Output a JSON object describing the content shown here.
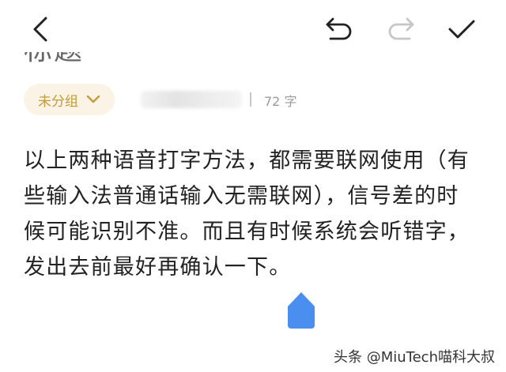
{
  "note": {
    "title": "标题",
    "group_label": "未分组",
    "char_count": "72 字",
    "body_lines": [
      "以上两种语音打字方法，都需要联网使用（有",
      "些输入法普通话输入无需联网），信号差的时",
      "候可能识别不准。而且有时候系统会听错字，",
      "发出去前最好再确认一下。"
    ]
  },
  "toolbar": {
    "back_icon": "chevron-left-icon",
    "undo_icon": "undo-icon",
    "redo_icon": "redo-icon",
    "redo_enabled": false,
    "done_icon": "checkmark-icon"
  },
  "watermark": "头条 @MiuTech喵科大叔",
  "colors": {
    "accent_gold": "#c49a3a",
    "chip_bg": "#fbf4e6",
    "cursor_blue": "#4a8ff0",
    "icon_dark": "#222222",
    "icon_disabled": "#c6c6c6"
  }
}
